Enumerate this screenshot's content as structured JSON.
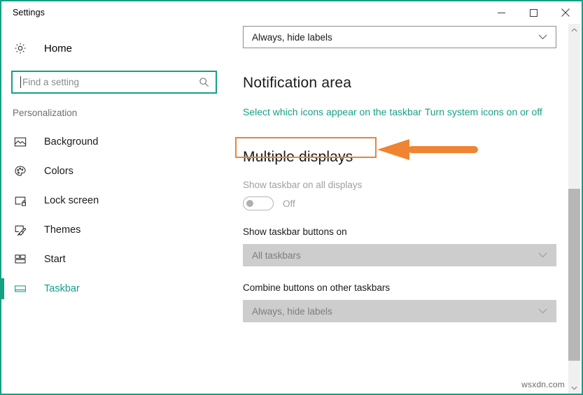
{
  "window": {
    "title": "Settings",
    "accent_color": "#16a085",
    "controls": [
      {
        "name": "minimize",
        "glyph": "minimize-icon"
      },
      {
        "name": "maximize",
        "glyph": "maximize-icon"
      },
      {
        "name": "close",
        "glyph": "close-icon"
      }
    ]
  },
  "sidebar": {
    "home_label": "Home",
    "home_icon": "gear-icon",
    "search": {
      "placeholder": "Find a setting",
      "value": "",
      "icon": "search-icon"
    },
    "section_label": "Personalization",
    "items": [
      {
        "label": "Background",
        "icon": "image-icon",
        "selected": false
      },
      {
        "label": "Colors",
        "icon": "palette-icon",
        "selected": false
      },
      {
        "label": "Lock screen",
        "icon": "lock-screen-icon",
        "selected": false
      },
      {
        "label": "Themes",
        "icon": "brush-icon",
        "selected": false
      },
      {
        "label": "Start",
        "icon": "tiles-icon",
        "selected": false
      },
      {
        "label": "Taskbar",
        "icon": "taskbar-icon",
        "selected": true
      }
    ]
  },
  "content": {
    "top_dropdown": {
      "value": "Always, hide labels",
      "enabled": true
    },
    "notification_area": {
      "heading": "Notification area",
      "links": [
        "Select which icons appear on the taskbar",
        "Turn system icons on or off"
      ]
    },
    "multiple_displays": {
      "heading": "Multiple displays",
      "show_taskbar_label": "Show taskbar on all displays",
      "toggle_state": "Off",
      "toggle_on": false,
      "show_buttons_label": "Show taskbar buttons on",
      "show_buttons_value": "All taskbars",
      "combine_label": "Combine buttons on other taskbars",
      "combine_value": "Always, hide labels"
    }
  },
  "annotation": {
    "color": "#e8843c",
    "target_link": "Turn system icons on or off",
    "arrow_direction": "left"
  },
  "scrollbar": {
    "up_arrow": "chevron-up-icon",
    "down_arrow": "chevron-down-icon",
    "position_percent": 45
  },
  "watermark": "wsxdn.com"
}
